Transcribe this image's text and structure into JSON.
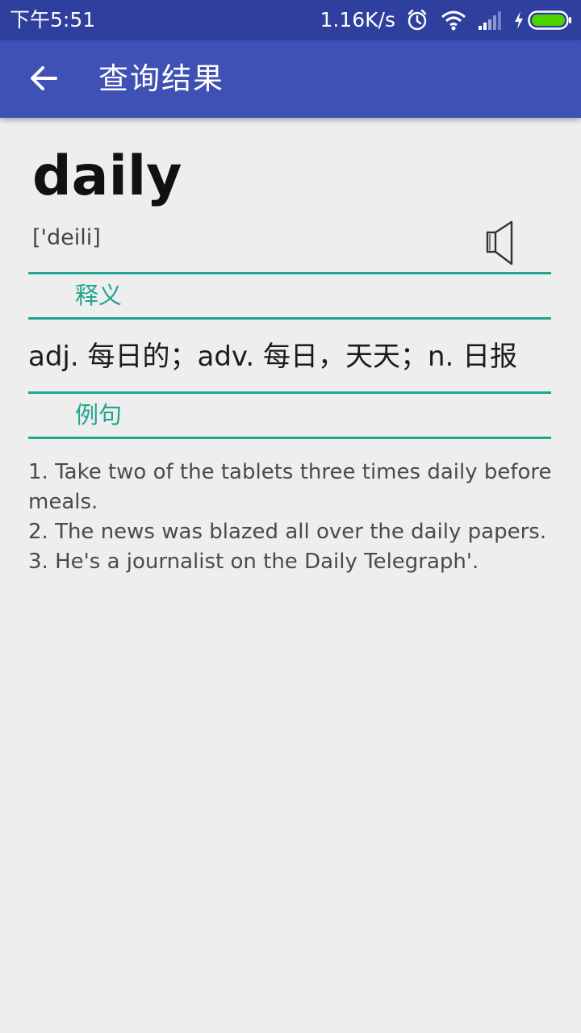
{
  "status_bar": {
    "time": "下午5:51",
    "net_speed": "1.16K/s",
    "icons": [
      "alarm-icon",
      "wifi-icon",
      "signal-icon",
      "charging-icon",
      "battery-icon"
    ],
    "battery_color": "#4cd400"
  },
  "app_bar": {
    "back_icon": "arrow-left-icon",
    "title": "查询结果",
    "color": "#3f51b5"
  },
  "entry": {
    "word": "daily",
    "phonetic": "['deili]",
    "speaker_icon": "speaker-icon",
    "definition_label": "释义",
    "definition": "adj. 每日的；adv. 每日，天天；n. 日报",
    "examples_label": "例句",
    "examples": [
      "1. Take two of the tablets three times daily before meals.",
      "2. The news was blazed all over the daily papers.",
      "3. He's a journalist on the Daily Telegraph'."
    ]
  },
  "accent_color": "#1fa68f"
}
